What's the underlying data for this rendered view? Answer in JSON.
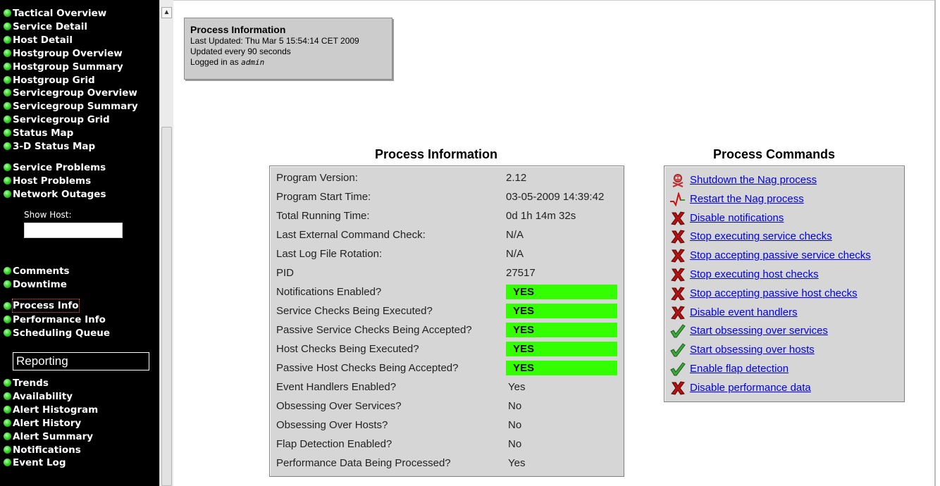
{
  "sidebar": {
    "nav_groups": [
      [
        "Tactical Overview",
        "Service Detail",
        "Host Detail",
        "Hostgroup Overview",
        "Hostgroup Summary",
        "Hostgroup Grid",
        "Servicegroup Overview",
        "Servicegroup Summary",
        "Servicegroup Grid",
        "Status Map",
        "3-D Status Map"
      ],
      [
        "Service Problems",
        "Host Problems",
        "Network Outages"
      ],
      [
        "Comments",
        "Downtime"
      ],
      [
        "Process Info",
        "Performance Info",
        "Scheduling Queue"
      ],
      [
        "Trends",
        "Availability",
        "Alert Histogram",
        "Alert History",
        "Alert Summary",
        "Notifications",
        "Event Log"
      ]
    ],
    "show_host_label": "Show Host:",
    "show_host_value": "",
    "reporting_label": "Reporting",
    "active_item": "Process Info"
  },
  "info_box": {
    "title": "Process Information",
    "last_updated": "Last Updated: Thu Mar 5 15:54:14 CET 2009",
    "update_interval": "Updated every 90 seconds",
    "logged_in_prefix": "Logged in as",
    "user": "admin"
  },
  "process_info": {
    "title": "Process Information",
    "rows": [
      {
        "label": "Program Version:",
        "value": "2.12",
        "style": "plain"
      },
      {
        "label": "Program Start Time:",
        "value": "03-05-2009 14:39:42",
        "style": "plain"
      },
      {
        "label": "Total Running Time:",
        "value": "0d 1h 14m 32s",
        "style": "plain"
      },
      {
        "label": "Last External Command Check:",
        "value": "N/A",
        "style": "plain"
      },
      {
        "label": "Last Log File Rotation:",
        "value": "N/A",
        "style": "plain"
      },
      {
        "label": "PID",
        "value": "27517",
        "style": "plain"
      },
      {
        "label": "Notifications Enabled?",
        "value": "YES",
        "style": "yes"
      },
      {
        "label": "Service Checks Being Executed?",
        "value": "YES",
        "style": "yes"
      },
      {
        "label": "Passive Service Checks Being Accepted?",
        "value": "YES",
        "style": "yes"
      },
      {
        "label": "Host Checks Being Executed?",
        "value": "YES",
        "style": "yes"
      },
      {
        "label": "Passive Host Checks Being Accepted?",
        "value": "YES",
        "style": "yes"
      },
      {
        "label": "Event Handlers Enabled?",
        "value": "Yes",
        "style": "flag"
      },
      {
        "label": "Obsessing Over Services?",
        "value": "No",
        "style": "flag"
      },
      {
        "label": "Obsessing Over Hosts?",
        "value": "No",
        "style": "flag"
      },
      {
        "label": "Flap Detection Enabled?",
        "value": "No",
        "style": "flag"
      },
      {
        "label": "Performance Data Being Processed?",
        "value": "Yes",
        "style": "flag"
      }
    ]
  },
  "process_commands": {
    "title": "Process Commands",
    "commands": [
      {
        "label": "Shutdown the Nag process",
        "icon": "skull-icon"
      },
      {
        "label": "Restart the Nag process",
        "icon": "heartbeat-icon"
      },
      {
        "label": "Disable notifications",
        "icon": "red-x-icon"
      },
      {
        "label": "Stop executing service checks",
        "icon": "red-x-icon"
      },
      {
        "label": "Stop accepting passive service checks",
        "icon": "red-x-icon"
      },
      {
        "label": "Stop executing host checks",
        "icon": "red-x-icon"
      },
      {
        "label": "Stop accepting passive host checks",
        "icon": "red-x-icon"
      },
      {
        "label": "Disable event handlers",
        "icon": "red-x-icon"
      },
      {
        "label": "Start obsessing over services",
        "icon": "green-check-icon"
      },
      {
        "label": "Start obsessing over hosts",
        "icon": "green-check-icon"
      },
      {
        "label": "Enable flap detection",
        "icon": "green-check-icon"
      },
      {
        "label": "Disable performance data",
        "icon": "red-x-icon"
      }
    ]
  },
  "colors": {
    "sidebar_bg": "#000000",
    "status_yes_bg": "#33ff00",
    "panel_bg": "#d6d6d6",
    "link": "#0000ee"
  }
}
